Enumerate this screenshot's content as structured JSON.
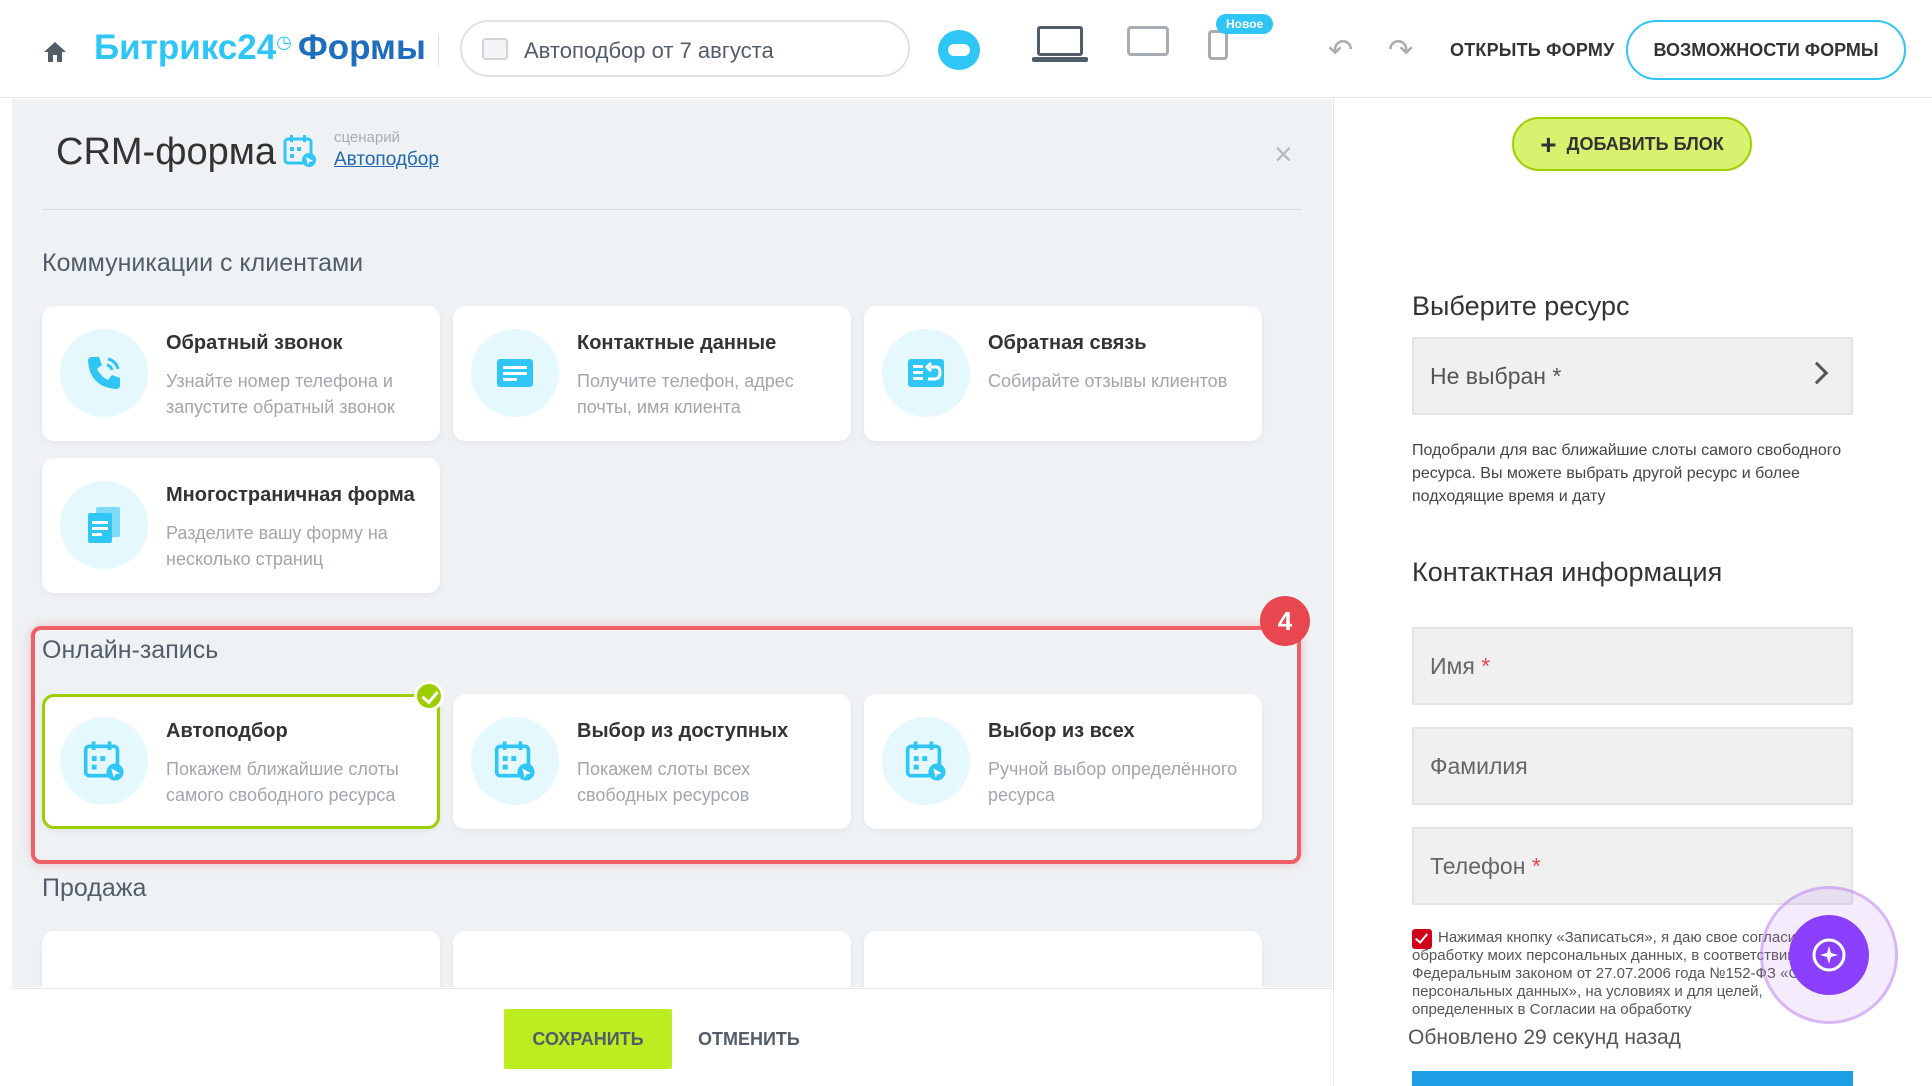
{
  "topbar": {
    "logo_brand": "Битрикс24",
    "logo_section": "Формы",
    "form_name": "Автоподбор от 7 августа",
    "new_badge": "Новое",
    "open_form": "ОТКРЫТЬ ФОРМУ",
    "form_features": "ВОЗМОЖНОСТИ ФОРМЫ",
    "icons": [
      "home-icon",
      "image-icon",
      "cloud-icon",
      "laptop-icon",
      "tablet-icon",
      "phone-icon",
      "undo-icon",
      "redo-icon"
    ]
  },
  "panel": {
    "title": "CRM-форма",
    "scenario_label": "сценарий",
    "scenario_value": "Автоподбор",
    "close": "×",
    "sections": [
      {
        "title": "Коммуникации с клиентами",
        "cards": [
          {
            "title": "Обратный звонок",
            "desc": "Узнайте номер телефона и запустите обратный звонок",
            "icon": "phone-call-icon"
          },
          {
            "title": "Контактные данные",
            "desc": "Получите телефон, адрес почты, имя клиента",
            "icon": "contact-card-icon"
          },
          {
            "title": "Обратная связь",
            "desc": "Собирайте отзывы клиентов",
            "icon": "feedback-icon"
          },
          {
            "title": "Многостраничная форма",
            "desc": "Разделите вашу форму на несколько страниц",
            "icon": "multipage-icon"
          }
        ]
      },
      {
        "title": "Онлайн-запись",
        "cards": [
          {
            "title": "Автоподбор",
            "desc": "Покажем ближайшие слоты самого свободного ресурса",
            "icon": "calendar-icon",
            "selected": true
          },
          {
            "title": "Выбор из доступных",
            "desc": "Покажем слоты всех свободных ресурсов",
            "icon": "calendar-icon"
          },
          {
            "title": "Выбор из всех",
            "desc": "Ручной выбор определённого ресурса",
            "icon": "calendar-icon"
          }
        ]
      },
      {
        "title": "Продажа",
        "cards": []
      }
    ],
    "step_number": "4"
  },
  "footer": {
    "save": "СОХРАНИТЬ",
    "cancel": "ОТМЕНИТЬ"
  },
  "preview": {
    "add_block": "ДОБАВИТЬ БЛОК",
    "resource_heading": "Выберите ресурс",
    "resource_value": "Не выбран",
    "required_mark": "*",
    "resource_hint": "Подобрали для вас ближайшие слоты самого свободного ресурса. Вы можете выбрать другой ресурс и более подходящие время и дату",
    "contact_heading": "Контактная информация",
    "fields": [
      {
        "label": "Имя",
        "required": true
      },
      {
        "label": "Фамилия",
        "required": false
      },
      {
        "label": "Телефон",
        "required": true
      }
    ],
    "consent_text": "Нажимая кнопку «Записаться», я даю свое согласие на обработку моих персональных данных, в соответствии с Федеральным законом от 27.07.2006 года №152-ФЗ «О персональных данных», на условиях и для целей, определенных в Согласии на обработку",
    "updated": "Обновлено 29 секунд назад"
  },
  "colors": {
    "accent_blue": "#2fc6f6",
    "brand_blue": "#1f6ebd",
    "green": "#9dcf00",
    "save_green": "#bbed21",
    "highlight_red": "#ee5f68"
  }
}
